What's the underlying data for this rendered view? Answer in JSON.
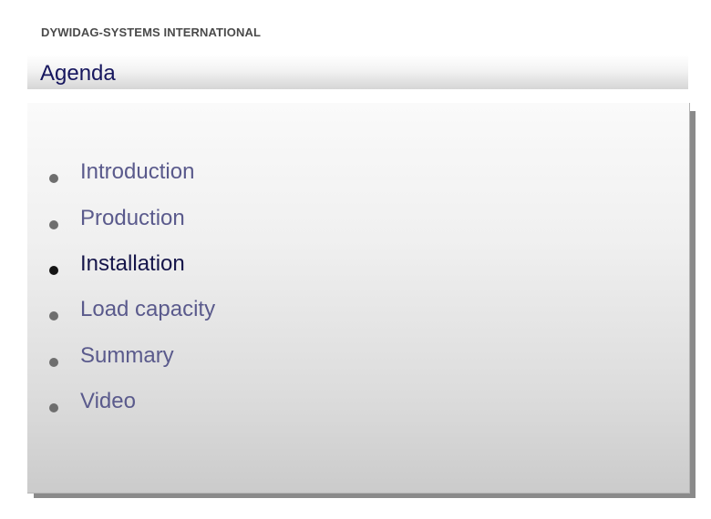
{
  "header": {
    "brand": "DYWIDAG-SYSTEMS INTERNATIONAL"
  },
  "slide": {
    "title": "Agenda"
  },
  "agenda": {
    "items": [
      {
        "label": "Introduction"
      },
      {
        "label": "Production"
      },
      {
        "label": "Installation"
      },
      {
        "label": "Load capacity"
      },
      {
        "label": "Summary"
      },
      {
        "label": "Video"
      }
    ],
    "highlighted_item": "Installation"
  },
  "colors": {
    "title": "#16165e",
    "item_text": "#5a5a8c",
    "highlighted_text": "#15154a",
    "bullet": "#6e6e6e",
    "highlighted_bullet": "#141414"
  }
}
